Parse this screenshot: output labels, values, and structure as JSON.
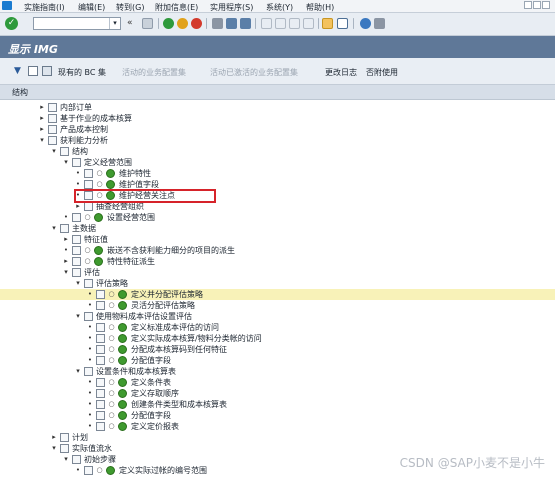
{
  "menubar": {
    "items": [
      "实施指南(I)",
      "编辑(E)",
      "转到(G)",
      "附加信息(E)",
      "实用程序(S)",
      "系统(Y)",
      "帮助(H)"
    ]
  },
  "toolbar": {
    "icons": [
      "enter-icon",
      "save-icon",
      "back-icon",
      "exit-icon",
      "cancel-icon",
      "print-icon",
      "find-icon",
      "find-next-icon",
      "first-page-icon",
      "prev-page-icon",
      "next-page-icon",
      "last-page-icon",
      "new-session-icon",
      "shortcut-icon",
      "help-icon",
      "layout-icon"
    ]
  },
  "title": "显示 IMG",
  "apptoolbar": {
    "existing_bc_sets": "现有的 BC 集",
    "bc_sets_for_activity": "活动的业务配置集",
    "activated_bc_sets": "活动已激活的业务配置集",
    "change_log": "更改日志",
    "release_notes": "否附使用"
  },
  "tree_header": "结构",
  "tree": [
    {
      "label": "内部订单",
      "indent": 0,
      "expand": "▸",
      "icon": "folder"
    },
    {
      "label": "基于作业的成本核算",
      "indent": 0,
      "expand": "▸",
      "icon": "folder"
    },
    {
      "label": "产品成本控制",
      "indent": 0,
      "expand": "▸",
      "icon": "folder"
    },
    {
      "label": "获利能力分析",
      "indent": 0,
      "expand": "▾",
      "icon": "folder"
    },
    {
      "label": "结构",
      "indent": 1,
      "expand": "▾",
      "icon": "folder"
    },
    {
      "label": "定义经营范围",
      "indent": 2,
      "expand": "▾",
      "icon": "folder"
    },
    {
      "label": "维护特性",
      "indent": 3,
      "expand": "•",
      "icon": "activity"
    },
    {
      "label": "维护值字段",
      "indent": 3,
      "expand": "•",
      "icon": "activity"
    },
    {
      "label": "维护经营关注点",
      "indent": 3,
      "expand": "•",
      "icon": "activity"
    },
    {
      "label": "抽查经营组织",
      "indent": 3,
      "expand": "▸",
      "icon": "folder"
    },
    {
      "label": "设置经营范围",
      "indent": 2,
      "expand": "•",
      "icon": "activity"
    },
    {
      "label": "主数据",
      "indent": 1,
      "expand": "▾",
      "icon": "folder"
    },
    {
      "label": "特征值",
      "indent": 2,
      "expand": "▸",
      "icon": "folder"
    },
    {
      "label": "嵌送不含获利能力细分的项目的派生",
      "indent": 2,
      "expand": "•",
      "icon": "activity"
    },
    {
      "label": "特性特征派生",
      "indent": 2,
      "expand": "▸",
      "icon": "activity"
    },
    {
      "label": "评估",
      "indent": 2,
      "expand": "▾",
      "icon": "folder"
    },
    {
      "label": "评估策略",
      "indent": 3,
      "expand": "▾",
      "icon": "folder"
    },
    {
      "label": "定义并分配评估策略",
      "indent": 4,
      "expand": "•",
      "icon": "activity",
      "highlight": true
    },
    {
      "label": "灵活分配评估策略",
      "indent": 4,
      "expand": "•",
      "icon": "activity"
    },
    {
      "label": "使用物料成本评估设置评估",
      "indent": 3,
      "expand": "▾",
      "icon": "folder"
    },
    {
      "label": "定义标准成本评估的访问",
      "indent": 4,
      "expand": "•",
      "icon": "activity"
    },
    {
      "label": "定义实际成本核算/物料分类帐的访问",
      "indent": 4,
      "expand": "•",
      "icon": "activity"
    },
    {
      "label": "分配成本核算码到任何特征",
      "indent": 4,
      "expand": "•",
      "icon": "activity"
    },
    {
      "label": "分配值字段",
      "indent": 4,
      "expand": "•",
      "icon": "activity"
    },
    {
      "label": "设置条件和成本核算表",
      "indent": 3,
      "expand": "▾",
      "icon": "folder"
    },
    {
      "label": "定义条件表",
      "indent": 4,
      "expand": "•",
      "icon": "activity"
    },
    {
      "label": "定义存取顺序",
      "indent": 4,
      "expand": "•",
      "icon": "activity"
    },
    {
      "label": "创建条件类型和成本核算表",
      "indent": 4,
      "expand": "•",
      "icon": "activity"
    },
    {
      "label": "分配值字段",
      "indent": 4,
      "expand": "•",
      "icon": "activity"
    },
    {
      "label": "定义定价报表",
      "indent": 4,
      "expand": "•",
      "icon": "activity"
    },
    {
      "label": "计划",
      "indent": 1,
      "expand": "▸",
      "icon": "folder"
    },
    {
      "label": "实际值流水",
      "indent": 1,
      "expand": "▾",
      "icon": "folder"
    },
    {
      "label": "初始步骤",
      "indent": 2,
      "expand": "▾",
      "icon": "folder"
    },
    {
      "label": "定义实际过帐的编号范围",
      "indent": 3,
      "expand": "•",
      "icon": "activity"
    }
  ],
  "watermark": "CSDN @SAP小麦不是小牛"
}
